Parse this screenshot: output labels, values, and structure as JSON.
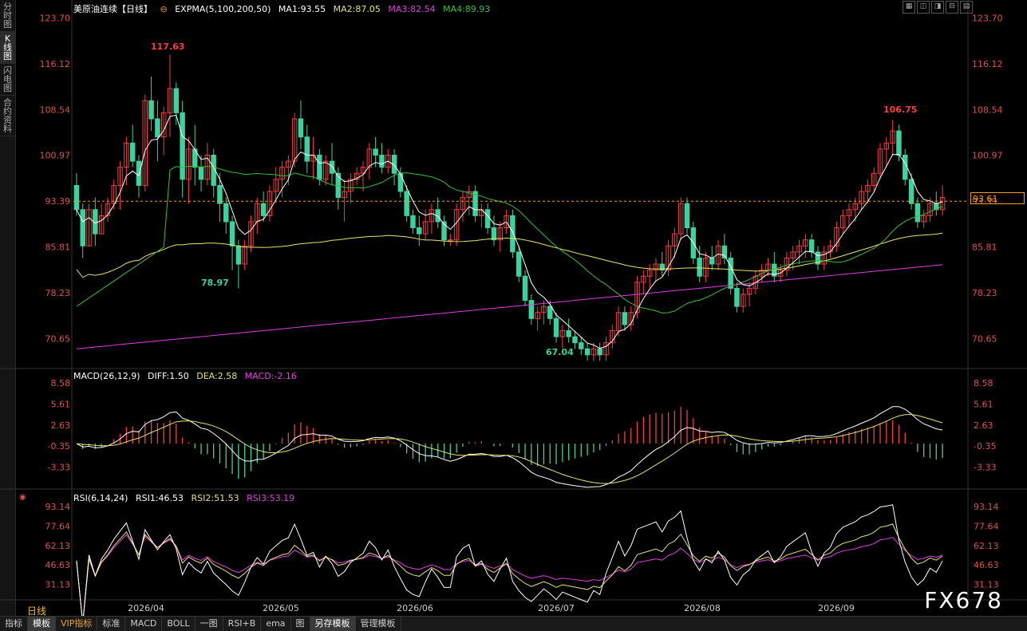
{
  "sidebar": {
    "tabs": [
      {
        "label": "分时图",
        "chars": [
          "分",
          "时",
          "图"
        ],
        "active": false
      },
      {
        "label": "K线图",
        "chars": [
          "K",
          "线",
          "图"
        ],
        "active": true
      },
      {
        "label": "闪电图",
        "chars": [
          "闪",
          "电",
          "图"
        ],
        "active": false
      },
      {
        "label": "合约资料",
        "chars": [
          "合",
          "约",
          "资",
          "料"
        ],
        "active": false
      }
    ]
  },
  "main_legend": {
    "title": "美原油连续【日线】",
    "ind": "EXPMA(5,100,200,50)",
    "ma1": "MA1:93.55",
    "ma2": "MA2:87.05",
    "ma3": "MA3:82.54",
    "ma4": "MA4:89.93"
  },
  "macd_legend": {
    "label": "MACD(26,12,9)",
    "diff": "DIFF:1.50",
    "dea": "DEA:2.58",
    "macd": "MACD:-2.16"
  },
  "rsi_legend": {
    "label": "RSI(6,14,24)",
    "rsi1": "RSI1:46.53",
    "rsi2": "RSI2:51.53",
    "rsi3": "RSI3:53.19"
  },
  "price_axis": [
    "123.70",
    "116.12",
    "108.54",
    "100.97",
    "93.39",
    "85.81",
    "78.23",
    "70.65"
  ],
  "macd_axis": [
    "8.58",
    "5.61",
    "2.63",
    "-0.35",
    "-3.33"
  ],
  "rsi_axis": [
    "93.14",
    "77.64",
    "62.13",
    "46.63",
    "31.13"
  ],
  "date_axis": [
    "2026/04",
    "2026/05",
    "2026/06",
    "2026/07",
    "2026/08",
    "2026/09"
  ],
  "annotations": {
    "high1": "117.63",
    "low1": "78.97",
    "low2": "67.04",
    "high2": "106.75"
  },
  "current_price": "93.61",
  "period": "日线",
  "watermark": "FX678",
  "bottom_tabs": [
    {
      "label": "指标",
      "active": false
    },
    {
      "label": "模板",
      "active": true
    },
    {
      "label": "VIP指标",
      "vip": true
    },
    {
      "label": "标准"
    },
    {
      "label": "MACD"
    },
    {
      "label": "BOLL"
    },
    {
      "label": "一图"
    },
    {
      "label": "RSI+B"
    },
    {
      "label": "ema"
    },
    {
      "label": "图"
    },
    {
      "label": "另存模板",
      "active": true
    },
    {
      "label": "管理模板"
    }
  ],
  "toolbar_icons": [
    "layout-icon",
    "split-icon",
    "left-right-icon",
    "up-down-icon",
    "grid-icon"
  ],
  "colors": {
    "up": "#ff3b3b",
    "down": "#3ad29f",
    "ma1": "#ffffff",
    "ma2": "#e8e36a",
    "ma3": "#e040e0",
    "ma4": "#35c235",
    "axis_red": "#e05050",
    "axis_green": "#d0d0d0"
  },
  "chart_data": {
    "type": "candlestick",
    "price_range": [
      66,
      124
    ],
    "candles": [
      [
        96,
        98,
        91,
        92
      ],
      [
        92,
        93,
        84,
        86
      ],
      [
        86,
        93,
        86,
        92
      ],
      [
        92,
        94,
        86,
        88
      ],
      [
        88,
        93,
        88,
        91
      ],
      [
        91,
        94,
        90,
        93
      ],
      [
        93,
        97,
        92,
        96
      ],
      [
        96,
        100,
        92,
        99
      ],
      [
        99,
        104,
        96,
        103
      ],
      [
        103,
        106,
        99,
        100
      ],
      [
        100,
        101,
        94,
        96
      ],
      [
        96,
        111,
        95,
        110
      ],
      [
        110,
        114,
        105,
        107
      ],
      [
        107,
        110,
        100,
        104
      ],
      [
        104,
        109,
        101,
        108
      ],
      [
        108,
        117.63,
        104,
        112
      ],
      [
        112,
        113,
        106,
        108
      ],
      [
        108,
        110,
        94,
        97
      ],
      [
        97,
        104,
        93,
        102
      ],
      [
        102,
        106,
        96,
        99
      ],
      [
        99,
        101,
        95,
        97
      ],
      [
        97,
        103,
        96,
        101
      ],
      [
        101,
        102,
        94,
        96
      ],
      [
        96,
        98,
        90,
        93
      ],
      [
        93,
        94,
        88,
        90
      ],
      [
        90,
        91,
        82,
        86
      ],
      [
        86,
        87,
        78.97,
        83
      ],
      [
        83,
        87,
        82,
        86
      ],
      [
        86,
        91,
        85,
        90
      ],
      [
        90,
        94,
        88,
        93
      ],
      [
        93,
        95,
        90,
        91
      ],
      [
        91,
        96,
        90,
        95
      ],
      [
        95,
        99,
        93,
        97
      ],
      [
        97,
        100,
        94,
        99
      ],
      [
        99,
        101,
        96,
        100
      ],
      [
        100,
        108,
        99,
        107
      ],
      [
        107,
        110,
        102,
        104
      ],
      [
        104,
        106,
        98,
        100
      ],
      [
        100,
        104,
        97,
        101
      ],
      [
        101,
        102,
        96,
        97
      ],
      [
        97,
        101,
        96,
        100
      ],
      [
        100,
        103,
        96,
        98
      ],
      [
        98,
        99,
        92,
        94
      ],
      [
        94,
        97,
        90,
        95
      ],
      [
        95,
        98,
        93,
        97
      ],
      [
        97,
        99,
        96,
        98
      ],
      [
        98,
        100,
        95,
        99
      ],
      [
        99,
        103,
        97,
        102
      ],
      [
        102,
        104,
        99,
        101
      ],
      [
        101,
        103,
        98,
        99
      ],
      [
        99,
        102,
        98,
        101
      ],
      [
        101,
        102,
        96,
        98
      ],
      [
        98,
        99,
        94,
        95
      ],
      [
        95,
        96,
        90,
        91
      ],
      [
        91,
        92,
        88,
        89
      ],
      [
        89,
        91,
        86,
        88
      ],
      [
        88,
        92,
        87,
        90
      ],
      [
        90,
        93,
        88,
        92
      ],
      [
        92,
        94,
        89,
        90
      ],
      [
        90,
        91,
        86,
        87
      ],
      [
        87,
        88,
        86,
        87
      ],
      [
        87,
        93,
        86,
        92
      ],
      [
        92,
        95,
        90,
        94
      ],
      [
        94,
        96,
        91,
        95
      ],
      [
        95,
        96,
        90,
        91
      ],
      [
        91,
        93,
        89,
        92
      ],
      [
        92,
        93,
        88,
        89
      ],
      [
        89,
        91,
        86,
        87
      ],
      [
        87,
        90,
        85,
        89
      ],
      [
        89,
        92,
        88,
        91
      ],
      [
        91,
        92,
        84,
        85
      ],
      [
        85,
        86,
        80,
        81
      ],
      [
        81,
        82,
        76,
        77
      ],
      [
        77,
        78,
        73,
        74
      ],
      [
        74,
        76,
        72,
        75
      ],
      [
        75,
        77,
        73,
        76
      ],
      [
        76,
        77,
        73,
        74
      ],
      [
        74,
        75,
        70,
        71
      ],
      [
        71,
        73,
        69,
        72
      ],
      [
        72,
        74,
        70,
        71
      ],
      [
        71,
        72,
        69,
        70
      ],
      [
        70,
        71,
        68,
        69
      ],
      [
        69,
        70,
        67.04,
        68
      ],
      [
        68,
        70,
        67,
        69
      ],
      [
        69,
        70,
        67,
        68
      ],
      [
        68,
        71,
        67,
        70
      ],
      [
        70,
        73,
        69,
        72
      ],
      [
        72,
        76,
        71,
        75
      ],
      [
        75,
        76,
        72,
        73
      ],
      [
        73,
        76,
        72,
        75
      ],
      [
        75,
        81,
        74,
        80
      ],
      [
        80,
        82,
        78,
        81
      ],
      [
        81,
        83,
        79,
        82
      ],
      [
        82,
        84,
        80,
        83
      ],
      [
        83,
        85,
        81,
        82
      ],
      [
        82,
        87,
        81,
        86
      ],
      [
        86,
        89,
        84,
        88
      ],
      [
        88,
        94,
        87,
        93
      ],
      [
        93,
        94,
        88,
        89
      ],
      [
        89,
        90,
        83,
        84
      ],
      [
        84,
        86,
        80,
        81
      ],
      [
        81,
        85,
        80,
        84
      ],
      [
        84,
        86,
        82,
        83
      ],
      [
        83,
        87,
        82,
        86
      ],
      [
        86,
        88,
        83,
        84
      ],
      [
        84,
        85,
        78,
        79
      ],
      [
        79,
        80,
        75,
        76
      ],
      [
        76,
        79,
        75,
        78
      ],
      [
        78,
        80,
        76,
        79
      ],
      [
        79,
        82,
        78,
        81
      ],
      [
        81,
        83,
        80,
        82
      ],
      [
        82,
        84,
        81,
        83
      ],
      [
        83,
        85,
        80,
        81
      ],
      [
        81,
        83,
        80,
        82
      ],
      [
        82,
        85,
        81,
        84
      ],
      [
        84,
        86,
        82,
        85
      ],
      [
        85,
        87,
        83,
        86
      ],
      [
        86,
        88,
        84,
        87
      ],
      [
        87,
        88,
        84,
        85
      ],
      [
        85,
        86,
        82,
        83
      ],
      [
        83,
        86,
        82,
        85
      ],
      [
        85,
        87,
        84,
        86
      ],
      [
        86,
        90,
        85,
        89
      ],
      [
        89,
        92,
        88,
        91
      ],
      [
        91,
        93,
        89,
        92
      ],
      [
        92,
        94,
        90,
        93
      ],
      [
        93,
        96,
        92,
        95
      ],
      [
        95,
        97,
        93,
        96
      ],
      [
        96,
        99,
        95,
        98
      ],
      [
        98,
        103,
        97,
        102
      ],
      [
        102,
        104,
        99,
        103
      ],
      [
        103,
        106.75,
        101,
        105
      ],
      [
        105,
        106,
        100,
        101
      ],
      [
        101,
        102,
        96,
        97
      ],
      [
        97,
        98,
        92,
        93
      ],
      [
        93,
        94,
        89,
        90
      ],
      [
        90,
        92,
        89,
        91
      ],
      [
        91,
        94,
        90,
        93
      ],
      [
        93,
        95,
        91,
        92
      ],
      [
        92,
        96,
        91,
        94
      ]
    ]
  }
}
